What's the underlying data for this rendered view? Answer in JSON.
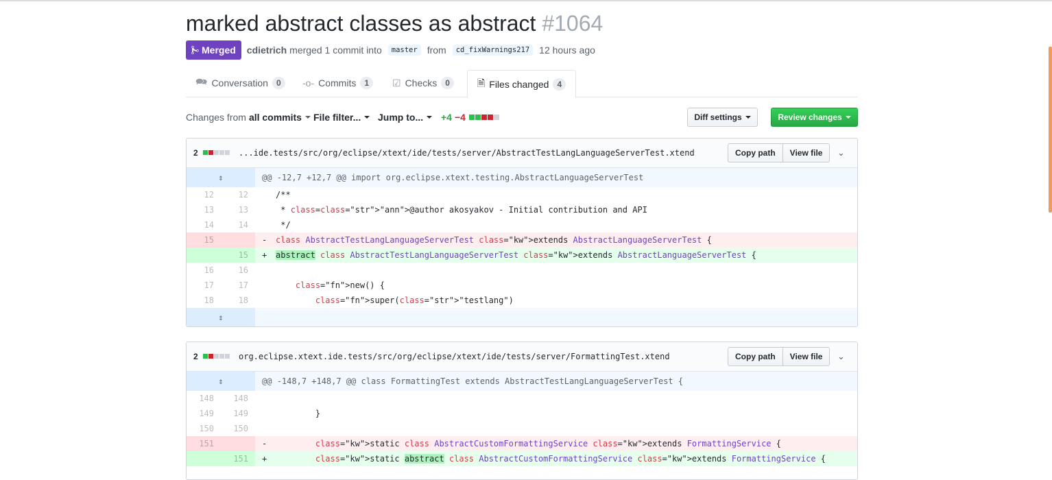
{
  "pr": {
    "title": "marked abstract classes as abstract",
    "number": "#1064",
    "state": "Merged",
    "author": "cdietrich",
    "action": "merged 1 commit into",
    "base_branch": "master",
    "from": "from",
    "head_branch": "cd_fixWarnings217",
    "time": "12 hours ago"
  },
  "tabs": [
    {
      "label": "Conversation",
      "count": "0",
      "icon": "comment-discussion-icon"
    },
    {
      "label": "Commits",
      "count": "1",
      "icon": "git-commit-icon"
    },
    {
      "label": "Checks",
      "count": "0",
      "icon": "checklist-icon"
    },
    {
      "label": "Files changed",
      "count": "4",
      "icon": "file-diff-icon",
      "selected": true
    }
  ],
  "toolbar": {
    "changes_from": "Changes from",
    "all_commits": "all commits",
    "file_filter": "File filter...",
    "jump_to": "Jump to...",
    "additions": "+4",
    "deletions": "−4",
    "diffstat": [
      "add",
      "add",
      "del",
      "del",
      "neutral"
    ],
    "diff_settings": "Diff settings",
    "review_changes": "Review changes"
  },
  "files": [
    {
      "count": "2",
      "diffstat": [
        "add",
        "del",
        "neutral",
        "neutral",
        "neutral"
      ],
      "path": "...ide.tests/src/org/eclipse/xtext/ide/tests/server/AbstractTestLangLanguageServerTest.xtend",
      "copy_path": "Copy path",
      "view_file": "View file",
      "hunk": "@@ -12,7 +12,7 @@ import org.eclipse.xtext.testing.AbstractLanguageServerTest",
      "lines": [
        {
          "old": "12",
          "new": "12",
          "type": "context",
          "text": "/**"
        },
        {
          "old": "13",
          "new": "13",
          "type": "context",
          "text": " * @author akosyakov - Initial contribution and API"
        },
        {
          "old": "14",
          "new": "14",
          "type": "context",
          "text": " */"
        },
        {
          "old": "15",
          "new": "",
          "type": "del",
          "text": "class AbstractTestLangLanguageServerTest extends AbstractLanguageServerTest {"
        },
        {
          "old": "",
          "new": "15",
          "type": "add",
          "text": "abstract class AbstractTestLangLanguageServerTest extends AbstractLanguageServerTest {"
        },
        {
          "old": "16",
          "new": "16",
          "type": "context",
          "text": ""
        },
        {
          "old": "17",
          "new": "17",
          "type": "context",
          "text": "    new() {"
        },
        {
          "old": "18",
          "new": "18",
          "type": "context",
          "text": "        super(\"testlang\")"
        }
      ]
    },
    {
      "count": "2",
      "diffstat": [
        "add",
        "del",
        "neutral",
        "neutral",
        "neutral"
      ],
      "path": "org.eclipse.xtext.ide.tests/src/org/eclipse/xtext/ide/tests/server/FormattingTest.xtend",
      "copy_path": "Copy path",
      "view_file": "View file",
      "hunk": "@@ -148,7 +148,7 @@ class FormattingTest extends AbstractTestLangLanguageServerTest {",
      "lines": [
        {
          "old": "148",
          "new": "148",
          "type": "context",
          "text": ""
        },
        {
          "old": "149",
          "new": "149",
          "type": "context",
          "text": "        }"
        },
        {
          "old": "150",
          "new": "150",
          "type": "context",
          "text": ""
        },
        {
          "old": "151",
          "new": "",
          "type": "del",
          "text": "        static class AbstractCustomFormattingService extends FormattingService {"
        },
        {
          "old": "",
          "new": "151",
          "type": "add",
          "text": "        static abstract class AbstractCustomFormattingService extends FormattingService {"
        }
      ]
    }
  ],
  "colors": {
    "merged": "#6f42c1",
    "primary_button": "#28a745",
    "add_line": "#e6ffed",
    "del_line": "#ffeef0",
    "hunk": "#f1f8ff"
  }
}
